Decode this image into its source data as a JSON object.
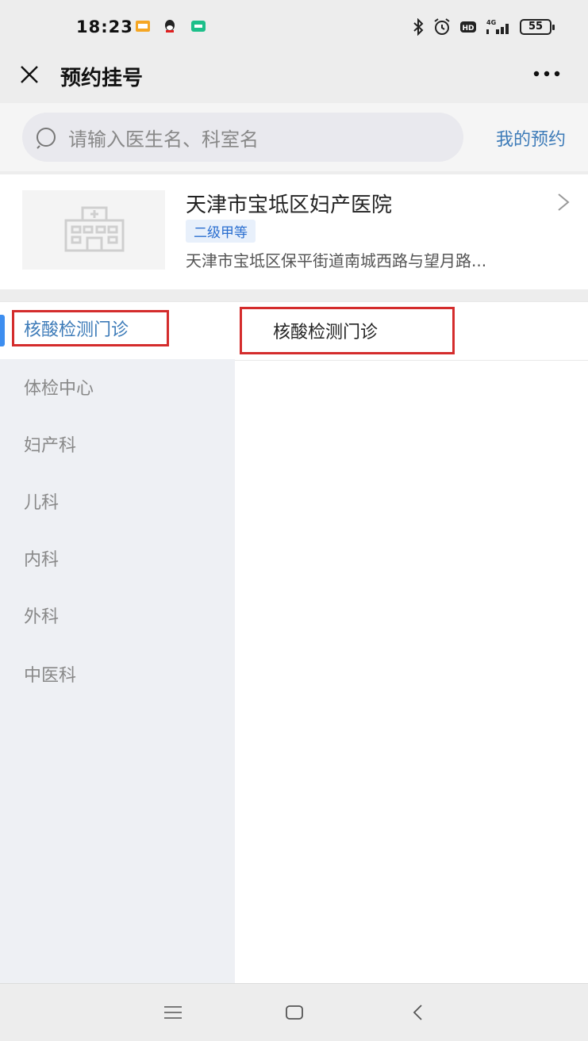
{
  "status_bar": {
    "time": "18:23",
    "battery": "55",
    "icons": [
      "message-notification-icon",
      "qq-icon",
      "app-notification-icon",
      "bluetooth-icon",
      "alarm-icon",
      "hd-icon",
      "signal-4g-icon",
      "battery-icon"
    ]
  },
  "header": {
    "title": "预约挂号",
    "close_icon": "close-icon",
    "more_icon": "more-icon"
  },
  "search": {
    "placeholder": "请输入医生名、科室名",
    "my_booking": "我的预约"
  },
  "hospital": {
    "name": "天津市宝坻区妇产医院",
    "grade": "二级甲等",
    "address": "天津市宝坻区保平街道南城西路与望月路..."
  },
  "departments": {
    "items": [
      {
        "label": "核酸检测门诊",
        "active": true
      },
      {
        "label": "体检中心"
      },
      {
        "label": "妇产科"
      },
      {
        "label": "儿科"
      },
      {
        "label": "内科"
      },
      {
        "label": "外科"
      },
      {
        "label": "中医科"
      }
    ],
    "content_title": "核酸检测门诊"
  },
  "colors": {
    "accent": "#3d7bb8",
    "active_marker": "#3d8ef0",
    "highlight_box": "#d42c2c"
  }
}
